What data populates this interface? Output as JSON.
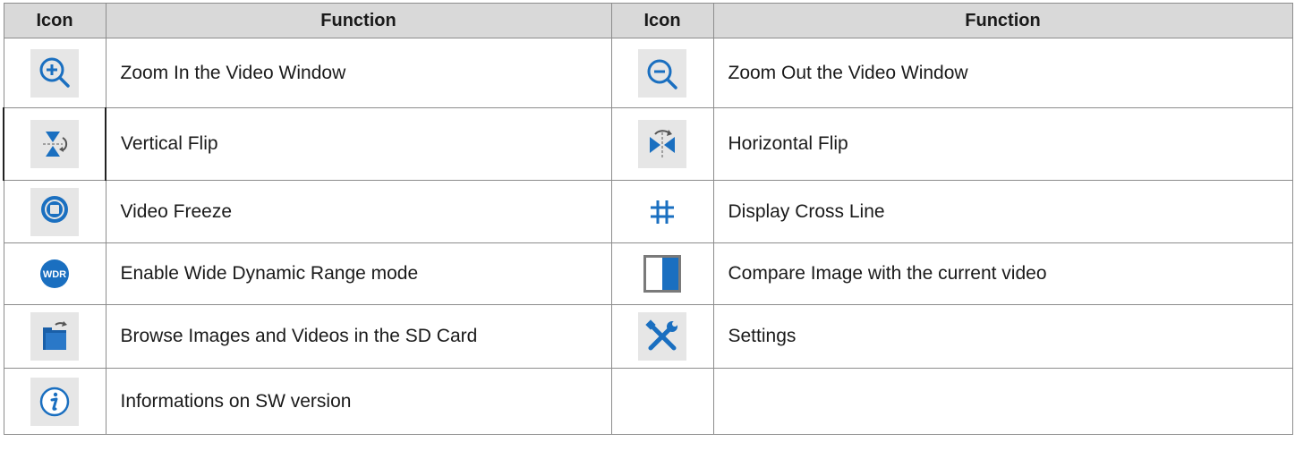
{
  "table": {
    "headers": [
      "Icon",
      "Function",
      "Icon",
      "Function"
    ],
    "rows": [
      {
        "left_icon": "zoom-in-icon",
        "left_label": "Zoom In the Video Window",
        "right_icon": "zoom-out-icon",
        "right_label": "Zoom Out the Video Window"
      },
      {
        "left_icon": "vertical-flip-icon",
        "left_label": "Vertical Flip",
        "right_icon": "horizontal-flip-icon",
        "right_label": "Horizontal Flip"
      },
      {
        "left_icon": "video-freeze-icon",
        "left_label": "Video Freeze",
        "right_icon": "cross-line-icon",
        "right_label": "Display Cross Line"
      },
      {
        "left_icon": "wdr-icon",
        "left_label": "Enable Wide Dynamic Range mode",
        "right_icon": "compare-icon",
        "right_label": "Compare Image with the current video"
      },
      {
        "left_icon": "folder-icon",
        "left_label": "Browse Images and Videos in the SD Card",
        "right_icon": "settings-icon",
        "right_label": "Settings"
      },
      {
        "left_icon": "info-icon",
        "left_label": "Informations on SW version",
        "right_icon": "",
        "right_label": ""
      }
    ]
  },
  "icons": {
    "wdr_text": "WDR"
  },
  "colors": {
    "accent_blue": "#1a6fc0",
    "header_bg": "#d9d9d9",
    "icon_bg": "#e6e6e6"
  }
}
